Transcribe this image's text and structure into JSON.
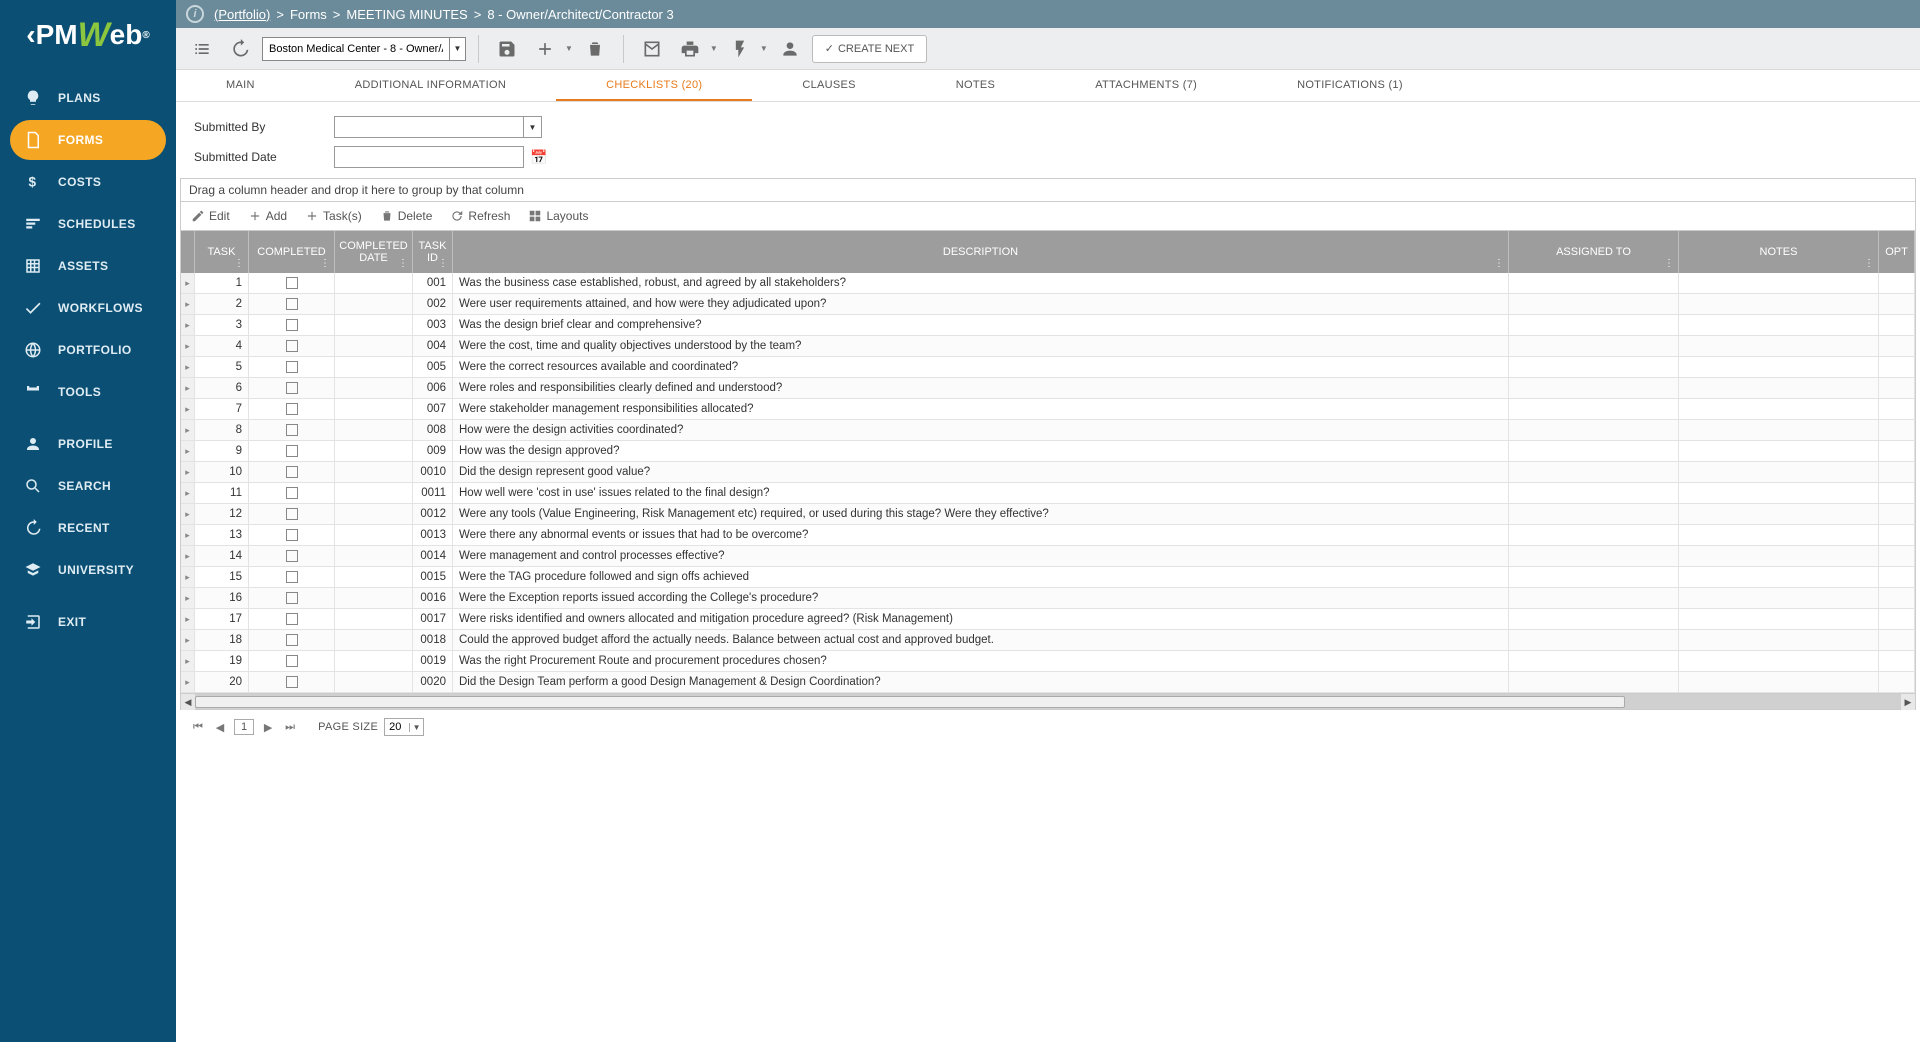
{
  "logo": {
    "pm": "PM",
    "w": "W",
    "eb": "eb"
  },
  "sidebar": [
    {
      "icon": "bulb",
      "label": "PLANS"
    },
    {
      "icon": "forms",
      "label": "FORMS",
      "active": true
    },
    {
      "icon": "dollar",
      "label": "COSTS"
    },
    {
      "icon": "sched",
      "label": "SCHEDULES"
    },
    {
      "icon": "assets",
      "label": "ASSETS"
    },
    {
      "icon": "check",
      "label": "WORKFLOWS"
    },
    {
      "icon": "globe",
      "label": "PORTFOLIO"
    },
    {
      "icon": "tools",
      "label": "TOOLS"
    },
    {
      "sep": true
    },
    {
      "icon": "profile",
      "label": "PROFILE"
    },
    {
      "icon": "search",
      "label": "SEARCH"
    },
    {
      "icon": "recent",
      "label": "RECENT"
    },
    {
      "icon": "univ",
      "label": "UNIVERSITY"
    },
    {
      "sep": true
    },
    {
      "icon": "exit",
      "label": "EXIT"
    }
  ],
  "breadcrumb": {
    "portfolio": "(Portfolio)",
    "s1": ">",
    "forms": "Forms",
    "s2": ">",
    "meeting": "MEETING MINUTES",
    "s3": ">",
    "rec": "8 - Owner/Architect/Contractor 3"
  },
  "toolbar": {
    "project_value": "Boston Medical Center - 8 - Owner/A",
    "create_label": "CREATE NEXT"
  },
  "tabs": [
    {
      "label": "MAIN"
    },
    {
      "label": "ADDITIONAL INFORMATION"
    },
    {
      "label": "CHECKLISTS (20)",
      "active": true
    },
    {
      "label": "CLAUSES"
    },
    {
      "label": "NOTES"
    },
    {
      "label": "ATTACHMENTS (7)"
    },
    {
      "label": "NOTIFICATIONS (1)"
    }
  ],
  "form": {
    "submitted_by_label": "Submitted By",
    "submitted_by_value": "",
    "submitted_date_label": "Submitted Date",
    "submitted_date_value": ""
  },
  "grid": {
    "group_hint": "Drag a column header and drop it here to group by that column",
    "toolbar": {
      "edit": "Edit",
      "add": "Add",
      "tasks": "Task(s)",
      "delete": "Delete",
      "refresh": "Refresh",
      "layouts": "Layouts"
    },
    "headers": {
      "task": "TASK",
      "completed": "COMPLETED",
      "cdate": "COMPLETED DATE",
      "tid": "TASK ID",
      "desc": "DESCRIPTION",
      "assn": "ASSIGNED TO",
      "notes": "NOTES",
      "opt": "OPT"
    },
    "rows": [
      {
        "n": "1",
        "tid": "001",
        "d": "Was the business case established, robust, and agreed by all stakeholders?"
      },
      {
        "n": "2",
        "tid": "002",
        "d": "Were user requirements attained, and how were they adjudicated upon?"
      },
      {
        "n": "3",
        "tid": "003",
        "d": "Was the design brief clear and comprehensive?"
      },
      {
        "n": "4",
        "tid": "004",
        "d": "Were the cost, time and quality objectives understood by the team?"
      },
      {
        "n": "5",
        "tid": "005",
        "d": "Were the correct resources available and coordinated?"
      },
      {
        "n": "6",
        "tid": "006",
        "d": "Were roles and responsibilities clearly defined and understood?"
      },
      {
        "n": "7",
        "tid": "007",
        "d": "Were stakeholder management responsibilities allocated?"
      },
      {
        "n": "8",
        "tid": "008",
        "d": "How were the design activities coordinated?"
      },
      {
        "n": "9",
        "tid": "009",
        "d": "How was the design approved?"
      },
      {
        "n": "10",
        "tid": "0010",
        "d": "Did the design represent good value?"
      },
      {
        "n": "11",
        "tid": "0011",
        "d": "How well were 'cost in use' issues related to the final design?"
      },
      {
        "n": "12",
        "tid": "0012",
        "d": "Were any tools (Value Engineering, Risk Management etc) required, or used during this stage? Were they effective?"
      },
      {
        "n": "13",
        "tid": "0013",
        "d": "Were there any abnormal events or issues that had to be overcome?"
      },
      {
        "n": "14",
        "tid": "0014",
        "d": "Were management and control processes effective?"
      },
      {
        "n": "15",
        "tid": "0015",
        "d": "Were the TAG procedure followed and sign offs achieved"
      },
      {
        "n": "16",
        "tid": "0016",
        "d": "Were the Exception reports issued according the College's procedure?"
      },
      {
        "n": "17",
        "tid": "0017",
        "d": "Were risks identified and owners allocated and mitigation procedure agreed? (Risk Management)"
      },
      {
        "n": "18",
        "tid": "0018",
        "d": "Could the approved budget afford the actually needs. Balance between actual cost and approved budget."
      },
      {
        "n": "19",
        "tid": "0019",
        "d": "Was the right Procurement Route and procurement procedures chosen?"
      },
      {
        "n": "20",
        "tid": "0020",
        "d": "Did the Design Team perform a good Design Management & Design Coordination?"
      }
    ]
  },
  "pager": {
    "page": "1",
    "page_size_label": "PAGE SIZE",
    "page_size": "20"
  }
}
